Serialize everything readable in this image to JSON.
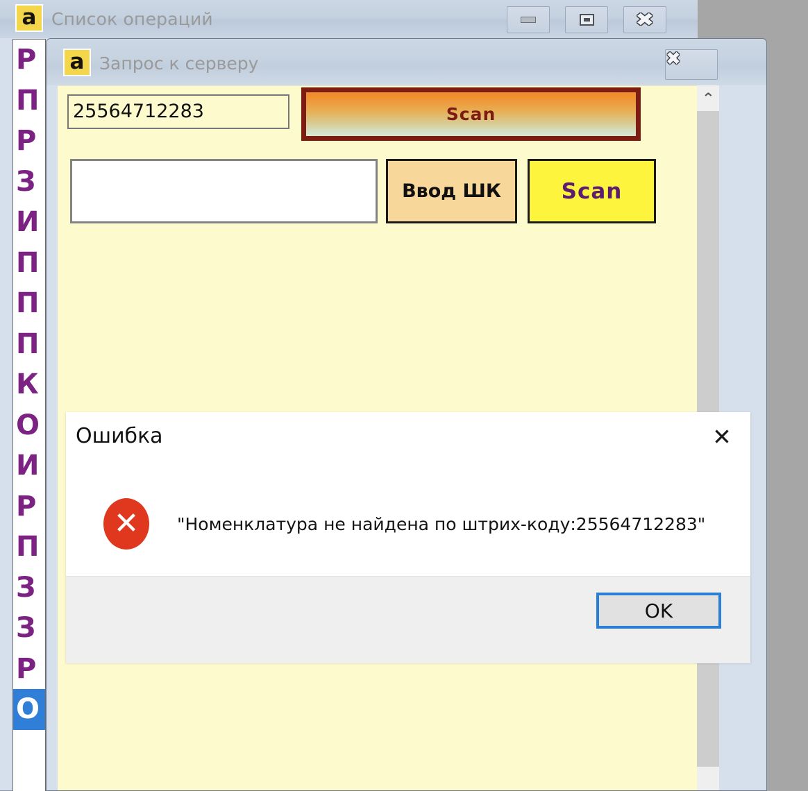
{
  "desktop": {
    "background": "#a6a6a6"
  },
  "outer_window": {
    "title": "Список операций",
    "icon": "app-1c-icon",
    "icon_glyph": "a",
    "controls": {
      "minimize_label": "minimize-icon",
      "restore_label": "restore-icon",
      "close_label": "close-icon",
      "close_glyph": "✖"
    }
  },
  "ops_list": {
    "items": [
      {
        "label": "Р",
        "selected": false
      },
      {
        "label": "П",
        "selected": false
      },
      {
        "label": "Р",
        "selected": false
      },
      {
        "label": "З",
        "selected": false
      },
      {
        "label": "И",
        "selected": false
      },
      {
        "label": "П",
        "selected": false
      },
      {
        "label": "П",
        "selected": false
      },
      {
        "label": "П",
        "selected": false
      },
      {
        "label": "К",
        "selected": false
      },
      {
        "label": "О",
        "selected": false
      },
      {
        "label": "И",
        "selected": false
      },
      {
        "label": "Р",
        "selected": false
      },
      {
        "label": "П",
        "selected": false
      },
      {
        "label": "З",
        "selected": false
      },
      {
        "label": "З",
        "selected": false
      },
      {
        "label": "Р",
        "selected": false
      },
      {
        "label": "О",
        "selected": true
      }
    ],
    "text_color": "#7b2283",
    "selected_background": "#2f7ed8"
  },
  "inner_window": {
    "title": "Запрос к серверу",
    "icon": "app-1c-icon",
    "icon_glyph": "a",
    "close_glyph": "✖",
    "form": {
      "barcode_input": {
        "value": "25564712283",
        "placeholder": ""
      },
      "scan_big_button": {
        "label": "Scan",
        "text_color": "#7c1c13",
        "border_color": "#7c1c13"
      },
      "text_input": {
        "value": "",
        "placeholder": ""
      },
      "vvod_shk_button": {
        "label": "Ввод ШК",
        "background": "#f8d79a",
        "text_color": "#111111"
      },
      "scan_small_button": {
        "label": "Scan",
        "background": "#fdf53d",
        "text_color": "#5c1d6e"
      },
      "background": "#fdfbcd"
    },
    "scrollbar": {
      "up_arrow": "chevron-up-icon",
      "up_glyph": "⌃",
      "thumb_color": "#cdcdcd"
    }
  },
  "error_dialog": {
    "title": "Ошибка",
    "close_glyph": "✕",
    "icon_name": "error-circle-icon",
    "icon_glyph": "✕",
    "icon_color": "#e0381f",
    "message": "\"Номенклатура не найдена по штрих-коду:25564712283\"",
    "ok_button": {
      "label": "OK",
      "focus_color": "#2a7fd4"
    }
  }
}
